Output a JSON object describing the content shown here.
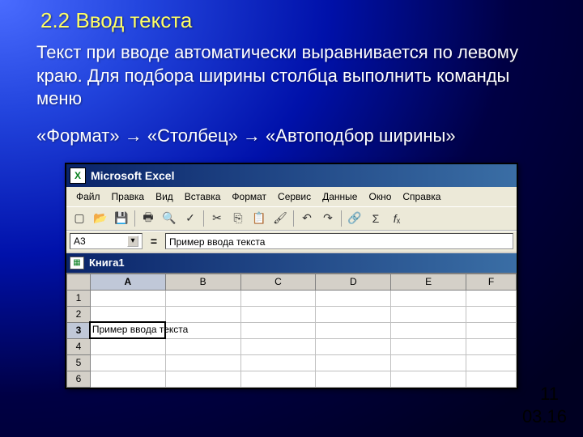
{
  "slide": {
    "heading": "2.2 Ввод текста",
    "para": "Текст при вводе автоматически выравнивается по левому краю. Для подбора ширины столбца выполнить команды меню",
    "path": "«Формат» → «Столбец» → «Автоподбор ширины»",
    "page_num": "11",
    "date": "03.16"
  },
  "excel": {
    "app_title": "Microsoft Excel",
    "menu": [
      "Файл",
      "Правка",
      "Вид",
      "Вставка",
      "Формат",
      "Сервис",
      "Данные",
      "Окно",
      "Справка"
    ],
    "namebox": "A3",
    "formula": "Пример ввода текста",
    "book": "Книга1",
    "columns": [
      "A",
      "B",
      "C",
      "D",
      "E",
      "F"
    ],
    "col_widths": [
      "90px",
      "90px",
      "90px",
      "90px",
      "90px",
      "60px"
    ],
    "rows": [
      "1",
      "2",
      "3",
      "4",
      "5",
      "6"
    ],
    "active_row": "3",
    "active_col": "A",
    "cell_text": "Пример ввода текста"
  }
}
